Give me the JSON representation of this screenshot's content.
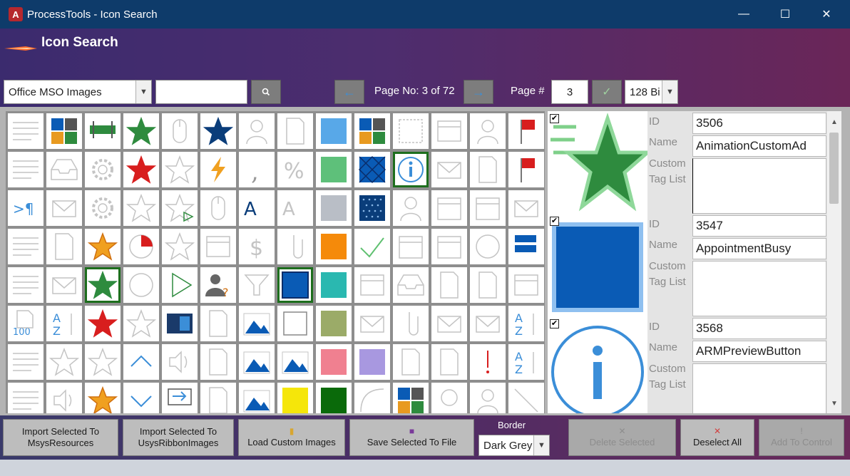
{
  "window": {
    "title": "ProcessTools - Icon Search",
    "minimize": "—",
    "maximize": "☐",
    "close": "✕",
    "app_icon_letter": "A"
  },
  "header": {
    "title": "Icon Search",
    "source_select": "Office MSO Images",
    "search_value": "",
    "page_info": "Page No: 3 of 72",
    "page_label": "Page #",
    "page_number": "3",
    "bits_select": "128 Bi"
  },
  "grid": {
    "rows": 8,
    "cols": 14,
    "selected_cells": [
      "r1c10",
      "r4c2",
      "r4c7"
    ]
  },
  "records": [
    {
      "checked": true,
      "id_label": "ID",
      "id": "3506",
      "name_label": "Name",
      "name": "AnimationCustomAd",
      "tag_label_1": "Custom",
      "tag_label_2": "Tag List",
      "tags": ""
    },
    {
      "checked": true,
      "id_label": "ID",
      "id": "3547",
      "name_label": "Name",
      "name": "AppointmentBusy",
      "tag_label_1": "Custom",
      "tag_label_2": "Tag List",
      "tags": ""
    },
    {
      "checked": true,
      "id_label": "ID",
      "id": "3568",
      "name_label": "Name",
      "name": "ARMPreviewButton",
      "tag_label_1": "Custom",
      "tag_label_2": "Tag List",
      "tags": ""
    }
  ],
  "footer": {
    "import_msys_line1": "Import Selected To",
    "import_msys_line2": "MsysResources",
    "import_usys_line1": "Import Selected To",
    "import_usys_line2": "UsysRibbonImages",
    "load_custom": "Load Custom Images",
    "save_selected": "Save Selected To File",
    "border_label": "Border",
    "border_value": "Dark Grey",
    "delete_selected": "Delete Selected",
    "deselect_all": "Deselect All",
    "add_to_control": "Add To Control"
  },
  "colors": {
    "titlebar": "#0e3b6a",
    "accent_green": "#1d6e1d",
    "star_green": "#2e8b3e",
    "busy_blue": "#0a5bb5",
    "icon_blue": "#3b8ed8"
  }
}
